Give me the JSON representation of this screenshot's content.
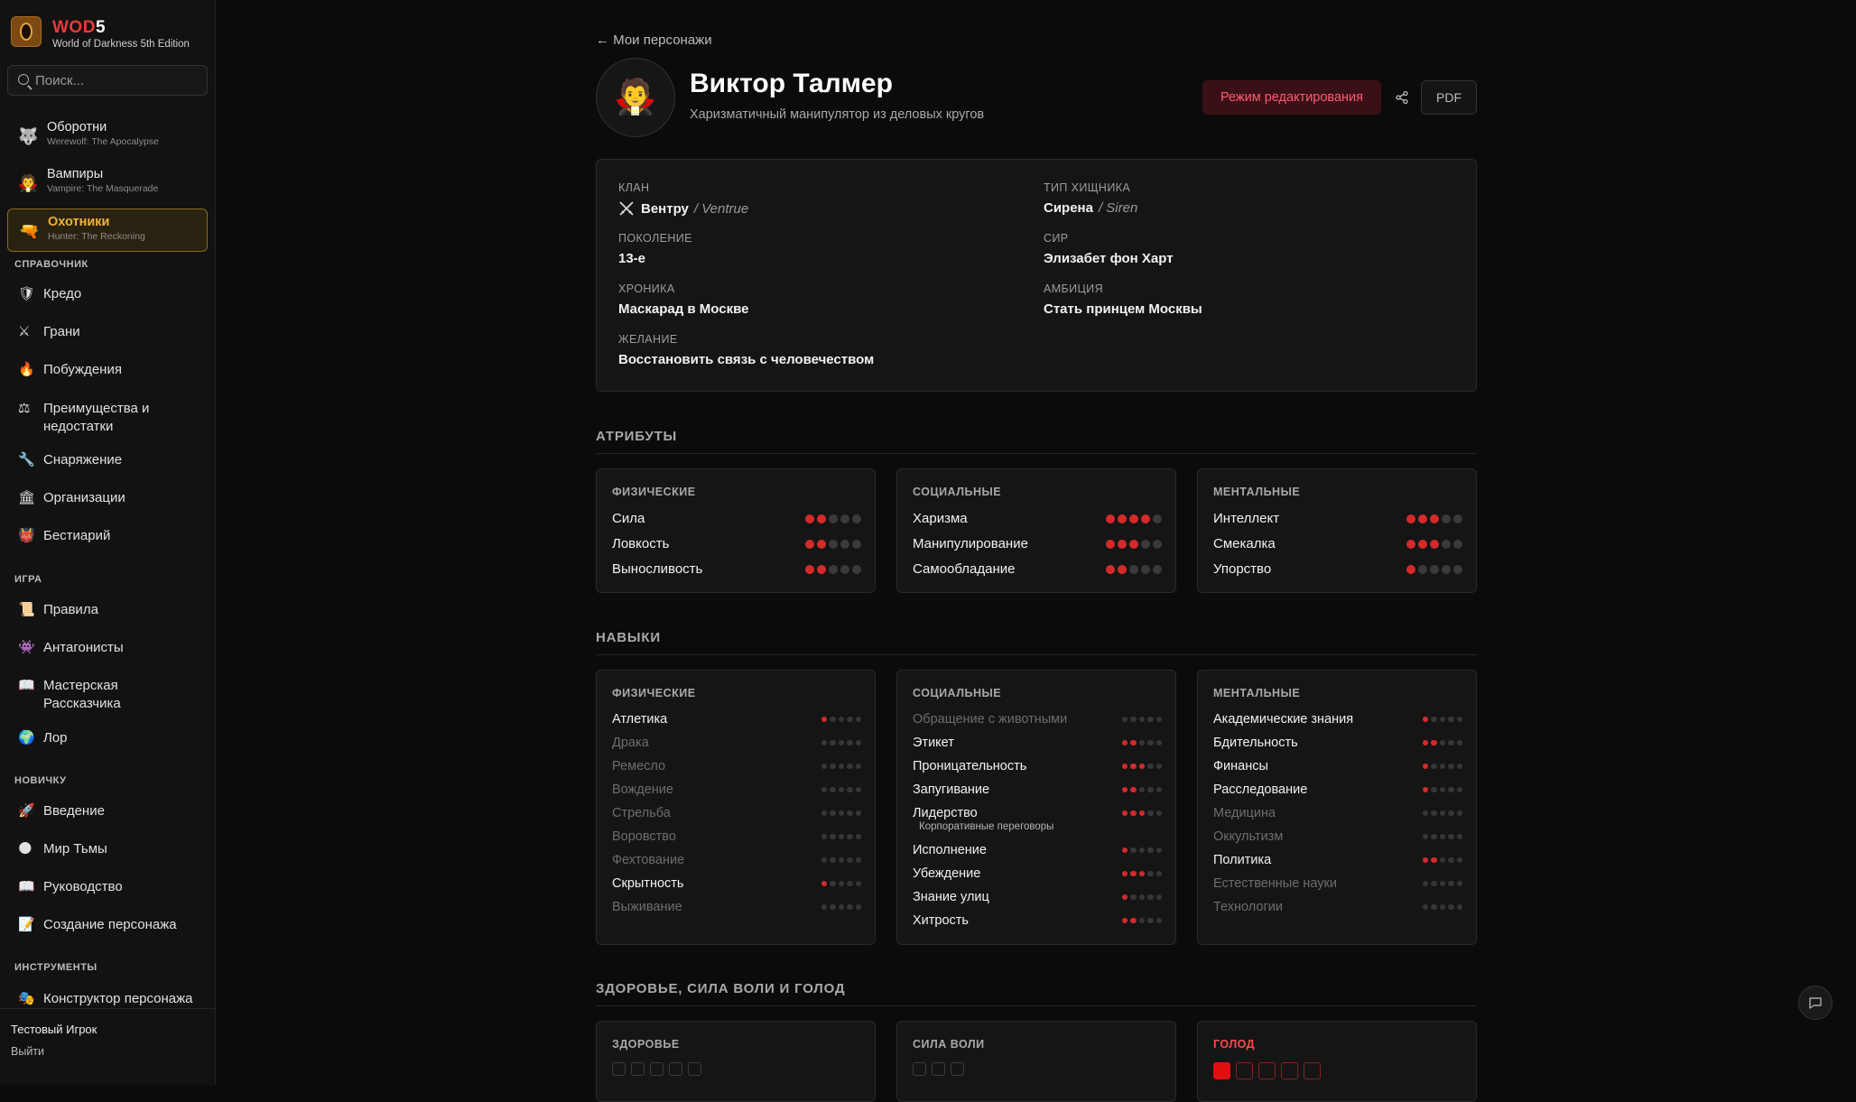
{
  "app": {
    "brand_main": "WOD",
    "brand_num": "5",
    "subtitle": "World of Darkness 5th Edition"
  },
  "search": {
    "placeholder": "Поиск..."
  },
  "games": [
    {
      "title": "Оборотни",
      "subtitle": "Werewolf: The Apocalypse",
      "icon": "wolf-icon"
    },
    {
      "title": "Вампиры",
      "subtitle": "Vampire: The Masquerade",
      "icon": "vampire-icon"
    },
    {
      "title": "Охотники",
      "subtitle": "Hunter: The Reckoning",
      "icon": "gun-icon",
      "active": true
    }
  ],
  "sections": {
    "reference": {
      "title": "СПРАВОЧНИК",
      "items": [
        {
          "label": "Кредо",
          "icon": "shield-icon"
        },
        {
          "label": "Грани",
          "icon": "crossed-swords-icon"
        },
        {
          "label": "Побуждения",
          "icon": "fire-icon"
        },
        {
          "label": "Преимущества и недостатки",
          "icon": "scales-icon"
        },
        {
          "label": "Снаряжение",
          "icon": "wrench-icon"
        },
        {
          "label": "Организации",
          "icon": "building-icon"
        },
        {
          "label": "Бестиарий",
          "icon": "demon-icon"
        }
      ]
    },
    "game": {
      "title": "ИГРА",
      "items": [
        {
          "label": "Правила",
          "icon": "scroll-icon"
        },
        {
          "label": "Антагонисты",
          "icon": "monster-icon"
        },
        {
          "label": "Мастерская Рассказчика",
          "icon": "book-icon"
        },
        {
          "label": "Лор",
          "icon": "globe-icon"
        }
      ]
    },
    "newbie": {
      "title": "НОВИЧКУ",
      "items": [
        {
          "label": "Введение",
          "icon": "rocket-icon"
        },
        {
          "label": "Мир Тьмы",
          "icon": "moon-icon"
        },
        {
          "label": "Руководство",
          "icon": "book-icon"
        },
        {
          "label": "Создание персонажа",
          "icon": "memo-icon"
        }
      ]
    },
    "tools": {
      "title": "ИНСТРУМЕНТЫ",
      "items": [
        {
          "label": "Конструктор персонажа",
          "icon": "masks-icon"
        }
      ]
    }
  },
  "user": {
    "name": "Тестовый Игрок",
    "logout": "Выйти"
  },
  "header": {
    "back": "← Мои персонажи",
    "name": "Виктор Талмер",
    "description": "Харизматичный манипулятор из деловых кругов",
    "edit_button": "Режим редактирования",
    "pdf_button": "PDF"
  },
  "info": {
    "clan": {
      "label": "КЛАН",
      "value": "Вентру",
      "alt": "/ Ventrue"
    },
    "generation": {
      "label": "ПОКОЛЕНИЕ",
      "value": "13-е"
    },
    "chronicle": {
      "label": "ХРОНИКА",
      "value": "Маскарад в Москве"
    },
    "desire": {
      "label": "ЖЕЛАНИЕ",
      "value": "Восстановить связь с человечеством"
    },
    "predator": {
      "label": "ТИП ХИЩНИКА",
      "value": "Сирена",
      "alt": "/ Siren"
    },
    "sire": {
      "label": "СИР",
      "value": "Элизабет фон Харт"
    },
    "ambition": {
      "label": "АМБИЦИЯ",
      "value": "Стать принцем Москвы"
    }
  },
  "attributes": {
    "title": "АТРИБУТЫ",
    "groups": [
      {
        "title": "ФИЗИЧЕСКИЕ",
        "items": [
          {
            "name": "Сила",
            "value": 2
          },
          {
            "name": "Ловкость",
            "value": 2
          },
          {
            "name": "Выносливость",
            "value": 2
          }
        ]
      },
      {
        "title": "СОЦИАЛЬНЫЕ",
        "items": [
          {
            "name": "Харизма",
            "value": 4
          },
          {
            "name": "Манипулирование",
            "value": 3
          },
          {
            "name": "Самообладание",
            "value": 2
          }
        ]
      },
      {
        "title": "МЕНТАЛЬНЫЕ",
        "items": [
          {
            "name": "Интеллект",
            "value": 3
          },
          {
            "name": "Смекалка",
            "value": 3
          },
          {
            "name": "Упорство",
            "value": 1
          }
        ]
      }
    ]
  },
  "skills": {
    "title": "НАВЫКИ",
    "groups": [
      {
        "title": "ФИЗИЧЕСКИЕ",
        "items": [
          {
            "name": "Атлетика",
            "value": 1
          },
          {
            "name": "Драка",
            "value": 0
          },
          {
            "name": "Ремесло",
            "value": 0
          },
          {
            "name": "Вождение",
            "value": 0
          },
          {
            "name": "Стрельба",
            "value": 0
          },
          {
            "name": "Воровство",
            "value": 0
          },
          {
            "name": "Фехтование",
            "value": 0
          },
          {
            "name": "Скрытность",
            "value": 1
          },
          {
            "name": "Выживание",
            "value": 0
          }
        ]
      },
      {
        "title": "СОЦИАЛЬНЫЕ",
        "items": [
          {
            "name": "Обращение с животными",
            "value": 0
          },
          {
            "name": "Этикет",
            "value": 2
          },
          {
            "name": "Проницательность",
            "value": 3
          },
          {
            "name": "Запугивание",
            "value": 2
          },
          {
            "name": "Лидерство",
            "value": 3,
            "specialty": "Корпоративные переговоры"
          },
          {
            "name": "Исполнение",
            "value": 1
          },
          {
            "name": "Убеждение",
            "value": 3
          },
          {
            "name": "Знание улиц",
            "value": 1
          },
          {
            "name": "Хитрость",
            "value": 2
          }
        ]
      },
      {
        "title": "МЕНТАЛЬНЫЕ",
        "items": [
          {
            "name": "Академические знания",
            "value": 1
          },
          {
            "name": "Бдительность",
            "value": 2
          },
          {
            "name": "Финансы",
            "value": 1
          },
          {
            "name": "Расследование",
            "value": 1
          },
          {
            "name": "Медицина",
            "value": 0
          },
          {
            "name": "Оккультизм",
            "value": 0
          },
          {
            "name": "Политика",
            "value": 2
          },
          {
            "name": "Естественные науки",
            "value": 0
          },
          {
            "name": "Технологии",
            "value": 0
          }
        ]
      }
    ]
  },
  "trackers": {
    "title": "ЗДОРОВЬЕ, СИЛА ВОЛИ И ГОЛОД",
    "health": {
      "label": "ЗДОРОВЬЕ",
      "boxes": 5,
      "damaged": 0
    },
    "willpower": {
      "label": "СИЛА ВОЛИ",
      "boxes": 3,
      "damaged": 0
    },
    "hunger": {
      "label": "ГОЛОД",
      "boxes": 5,
      "filled": 1
    }
  },
  "colors": {
    "accent": "#d42a2a",
    "active_game": "#f0b33a",
    "edit": "#ff5a72"
  }
}
